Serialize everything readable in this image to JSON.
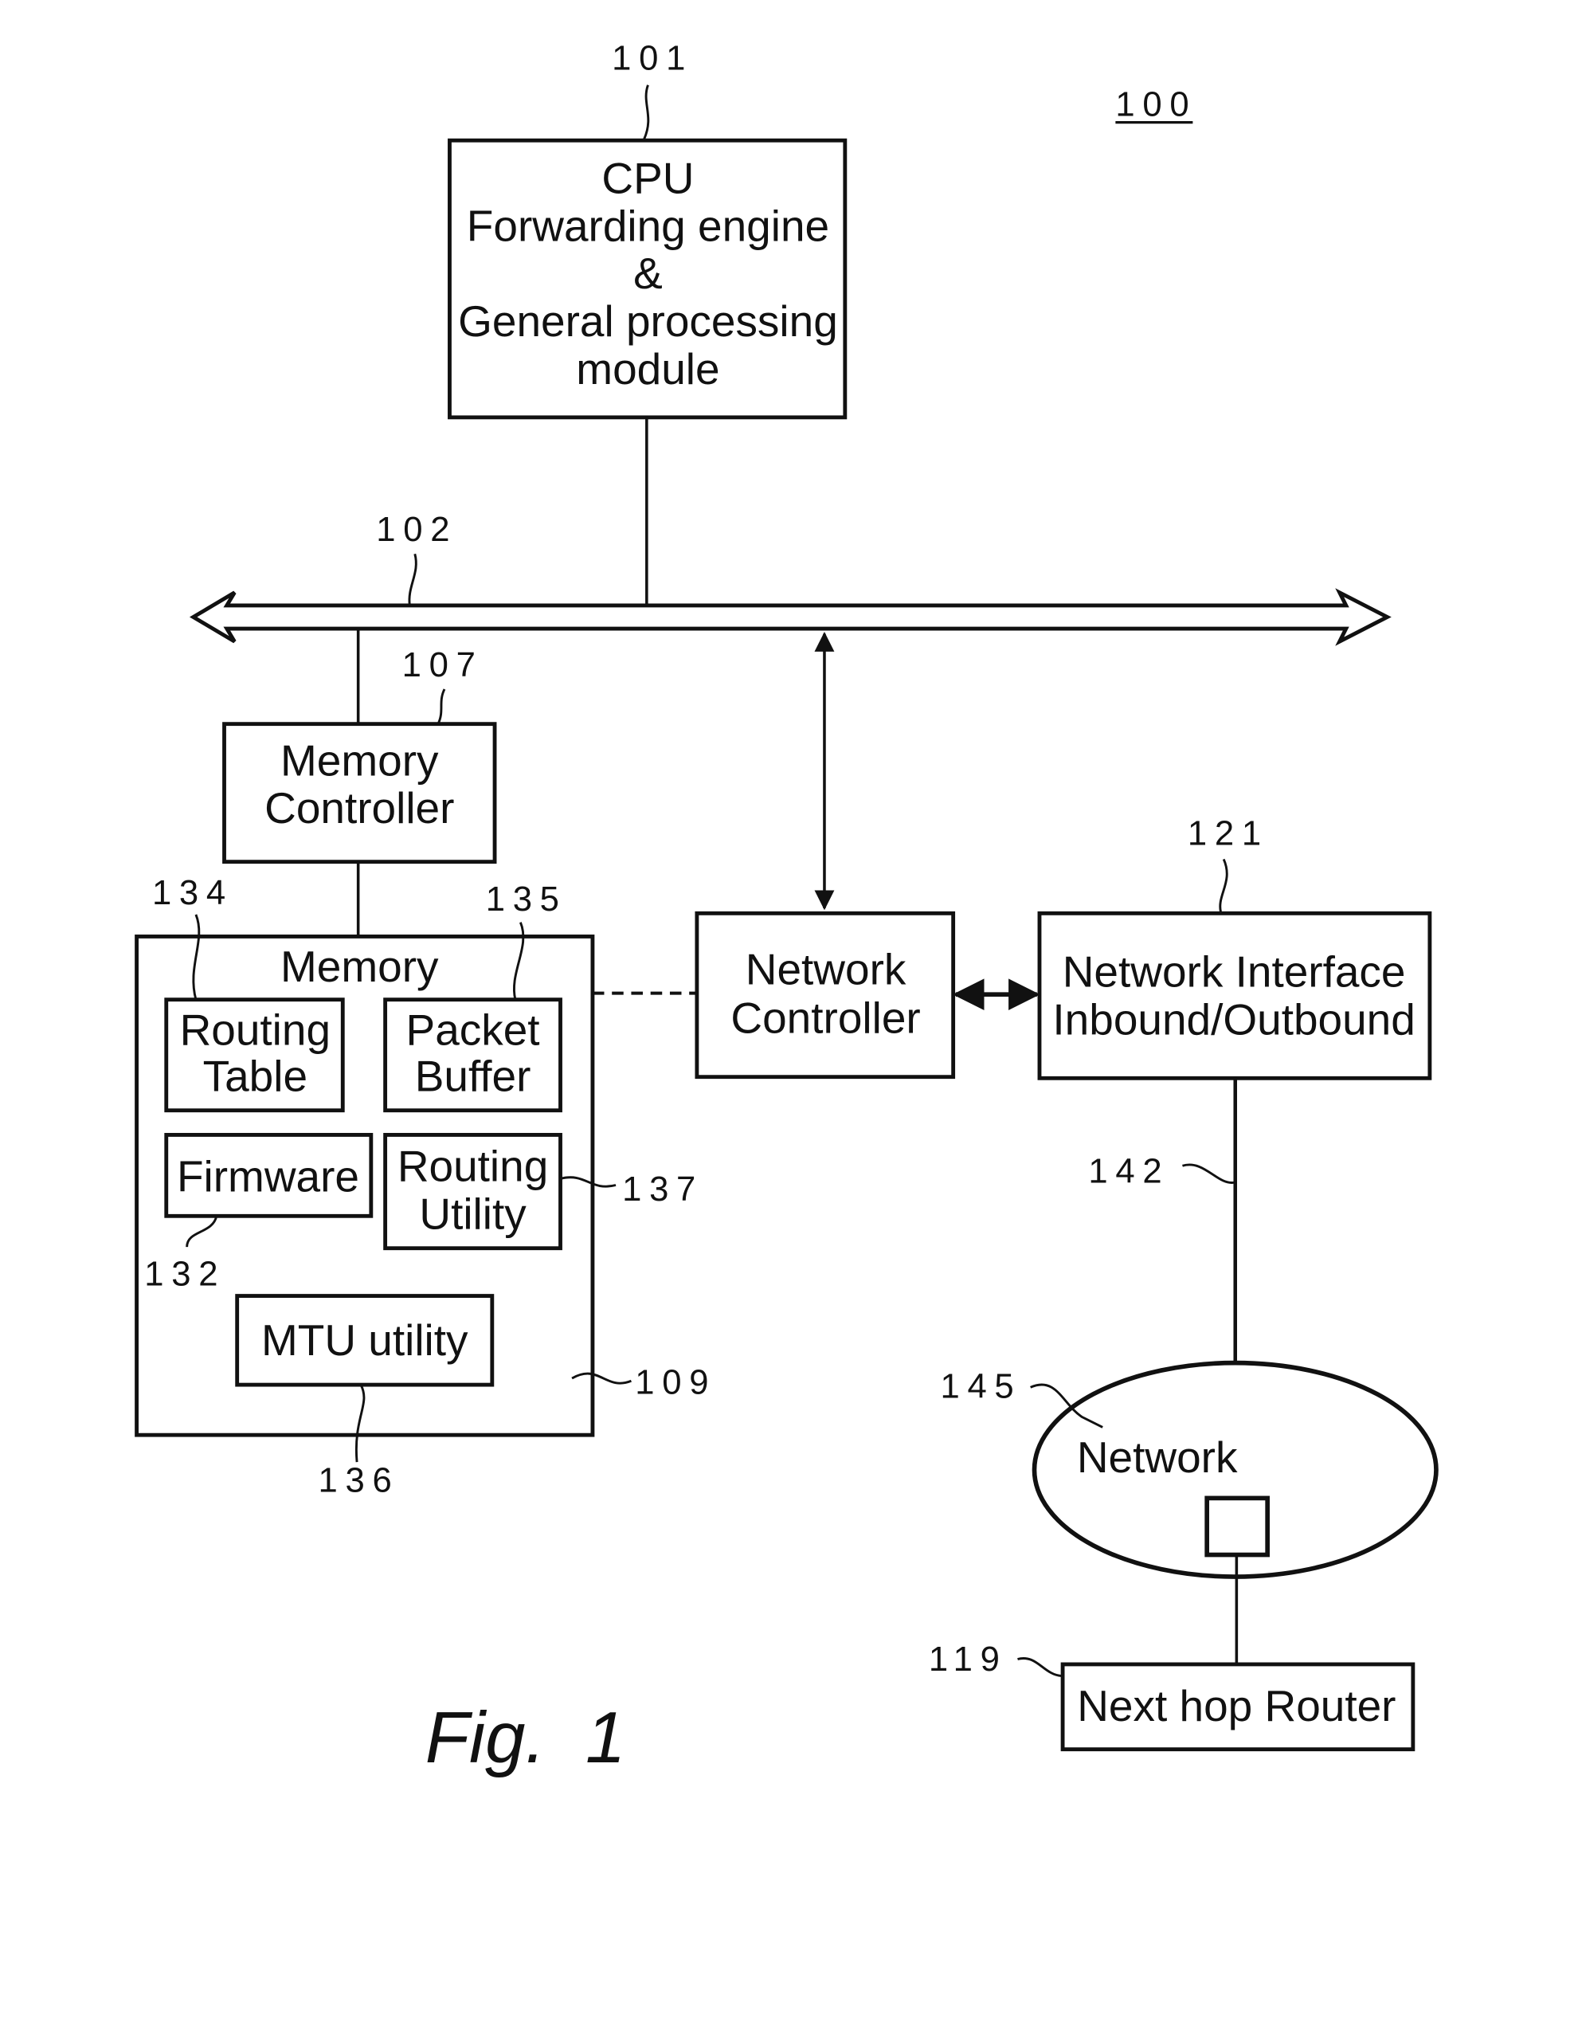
{
  "figure": {
    "number_label": "100",
    "caption": "Fig.  1"
  },
  "blocks": {
    "cpu": {
      "ref": "101",
      "lines": [
        "CPU",
        "Forwarding engine",
        "&",
        "General processing",
        "module"
      ]
    },
    "bus": {
      "ref": "102"
    },
    "memory_controller": {
      "ref": "107",
      "lines": [
        "Memory",
        "Controller"
      ]
    },
    "memory": {
      "ref": "109",
      "title": "Memory"
    },
    "routing_table": {
      "ref": "134",
      "lines": [
        "Routing",
        "Table"
      ]
    },
    "packet_buffer": {
      "ref": "135",
      "lines": [
        "Packet",
        "Buffer"
      ]
    },
    "firmware": {
      "ref": "132",
      "lines": [
        "Firmware"
      ]
    },
    "routing_utility": {
      "ref": "137",
      "lines": [
        "Routing",
        "Utility"
      ]
    },
    "mtu_utility": {
      "ref": "136",
      "lines": [
        "MTU utility"
      ]
    },
    "network_controller": {
      "lines": [
        "Network",
        "Controller"
      ]
    },
    "network_interface": {
      "ref": "121",
      "lines": [
        "Network Interface",
        "Inbound/Outbound"
      ]
    },
    "link": {
      "ref": "142"
    },
    "network": {
      "ref": "145",
      "label": "Network"
    },
    "next_hop_router": {
      "ref": "119",
      "lines": [
        "Next hop Router"
      ]
    }
  },
  "colors": {
    "ink": "#111111",
    "background": "#ffffff"
  }
}
